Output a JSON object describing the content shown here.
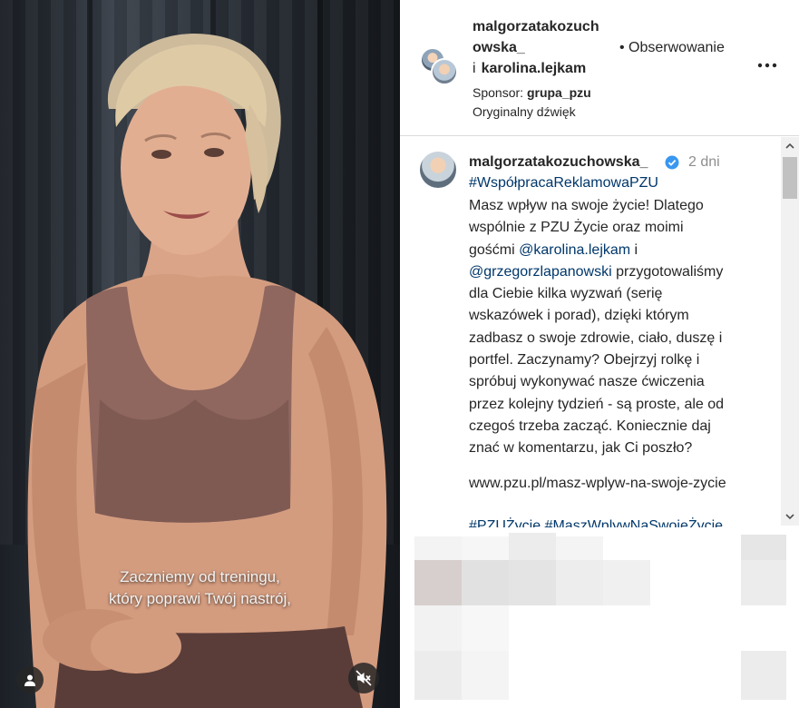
{
  "video": {
    "subtitle_line1": "Zaczniemy od treningu,",
    "subtitle_line2": "który poprawi Twój nastrój,",
    "tag_icon": "person-icon",
    "mute_icon": "speaker-muted-icon"
  },
  "header": {
    "username_line1": "malgorzatakozuch",
    "username_line2": "owska_",
    "and_word": "i",
    "coauthor": "karolina.lejkam",
    "follow_label": "• Obserwowanie",
    "sponsor_label": "Sponsor:",
    "sponsor_name": "grupa_pzu",
    "audio_label": "Oryginalny dźwięk",
    "more_icon": "more-horizontal-icon"
  },
  "caption": {
    "username": "malgorzatakozuchowska_",
    "time": "2 dni",
    "hashtag": "#WspółpracaReklamowaPZU",
    "lines": [
      "Masz wpływ na swoje życie! Dlatego",
      "wspólnie z PZU Życie oraz moimi",
      "gośćmi",
      "@karolina.lejkam",
      "i",
      "@grzegorzlapanowski",
      "przygotowaliśmy",
      "dla Ciebie kilka wyzwań (serię",
      "wskazówek i porad), dzięki którym",
      "zadbasz o swoje zdrowie, ciało, duszę i",
      "portfel. Zaczynamy? Obejrzyj rolkę i",
      "spróbuj wykonywać nasze ćwiczenia",
      "przez kolejny tydzień - są proste, ale od",
      "czegoś trzeba zacząć. Koniecznie daj",
      "znać w komentarzu, jak Ci poszło?"
    ],
    "link": "www.pzu.pl/masz-wplyw-na-swoje-zycie",
    "tags_partial": "#PZUŻycie #MaszWplywNaSwojeŻycie",
    "verified_color": "#3897f0",
    "link_color": "#00376b"
  }
}
